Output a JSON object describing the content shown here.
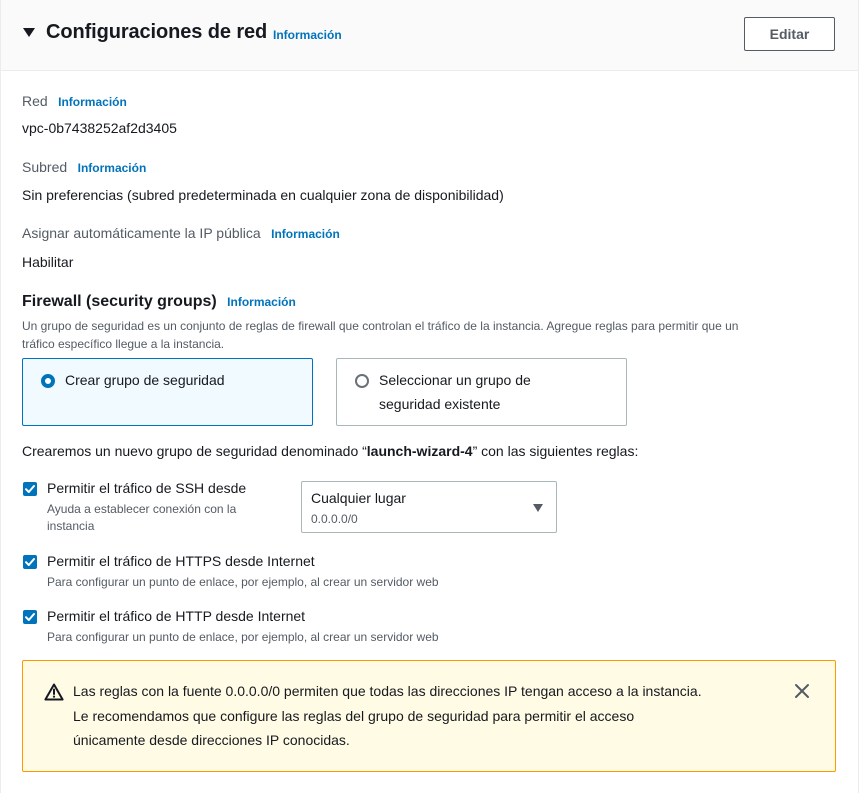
{
  "header": {
    "title": "Configuraciones de red",
    "info": "Información",
    "edit_label": "Editar"
  },
  "fields": {
    "network_label": "Red",
    "network_info": "Información",
    "network_value": "vpc-0b7438252af2d3405",
    "subnet_label": "Subred",
    "subnet_info": "Información",
    "subnet_value": "Sin preferencias (subred predeterminada en cualquier zona de disponibilidad)",
    "public_ip_label": "Asignar automáticamente la IP pública",
    "public_ip_info": "Información",
    "public_ip_value": "Habilitar"
  },
  "firewall": {
    "title": "Firewall (security groups)",
    "info": "Información",
    "description_line1": "Un grupo de seguridad es un conjunto de reglas de firewall que controlan el tráfico de la instancia. Agregue reglas para permitir que un",
    "description_line2": "tráfico específico llegue a la instancia.",
    "options": [
      {
        "label": "Crear grupo de seguridad",
        "selected": true
      },
      {
        "label_line1": "Seleccionar un grupo de",
        "label_line2": "seguridad existente",
        "selected": false
      }
    ],
    "new_group_prefix": "Crearemos un nuevo grupo de seguridad denominado “",
    "new_group_name": "launch-wizard-4",
    "new_group_suffix": "” con las siguientes reglas:"
  },
  "rules": [
    {
      "label": "Permitir el tráfico de SSH desde",
      "desc_line1": "Ayuda a establecer conexión con la",
      "desc_line2": "instancia",
      "checked": true
    },
    {
      "label": "Permitir el tráfico de HTTPS desde Internet",
      "desc": "Para configurar un punto de enlace, por ejemplo, al crear un servidor web",
      "checked": true
    },
    {
      "label": "Permitir el tráfico de HTTP desde Internet",
      "desc": "Para configurar un punto de enlace, por ejemplo, al crear un servidor web",
      "checked": true
    }
  ],
  "ssh_source": {
    "selected": "Cualquier lugar",
    "detail": "0.0.0.0/0"
  },
  "alert": {
    "line1": "Las reglas con la fuente 0.0.0.0/0 permiten que todas las direcciones IP tengan acceso a la instancia.",
    "line2": "Le recomendamos que configure las reglas del grupo de seguridad para permitir el acceso",
    "line3": "únicamente desde direcciones IP conocidas.",
    "icon": "warning-icon"
  },
  "colors": {
    "accent": "#0073bb",
    "warning_border": "#ff9900",
    "warning_bg": "#fffbe5"
  }
}
